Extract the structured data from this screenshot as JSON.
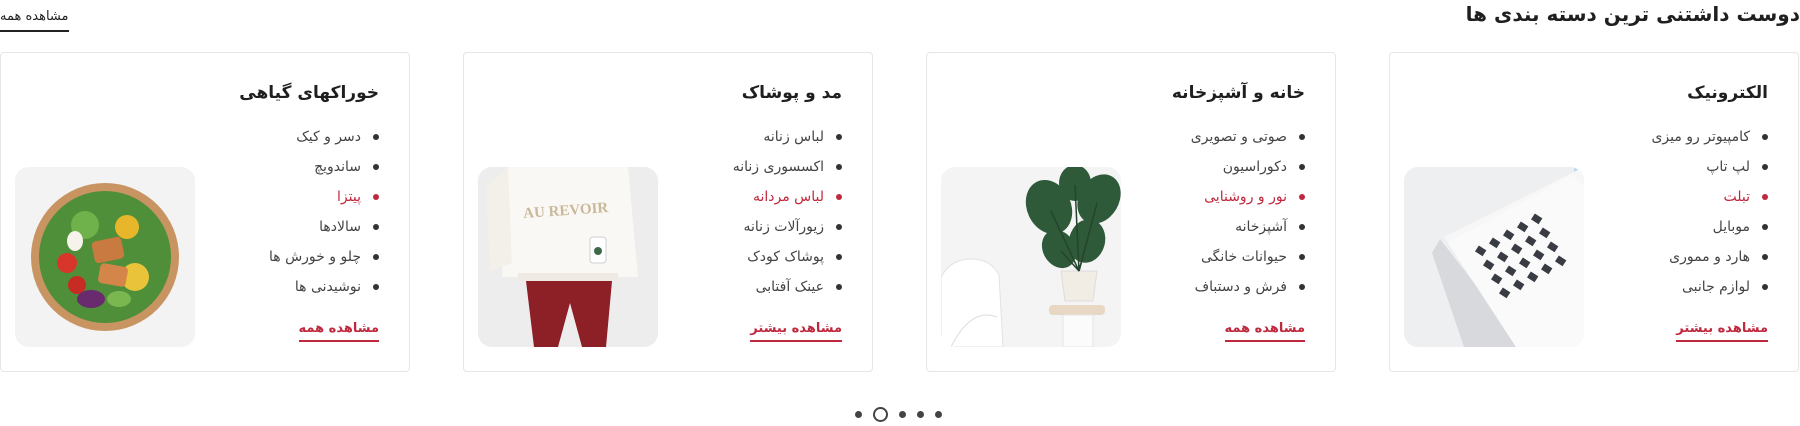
{
  "header": {
    "title": "دوست داشتنی ترین دسته بندی ها",
    "view_all": "مشاهده همه"
  },
  "accent_color": "#c0283d",
  "cards": [
    {
      "title": "الکترونیک",
      "items": [
        "کامپیوتر رو میزی",
        "لپ تاپ",
        "تبلت",
        "موبایل",
        "هارد و مموری",
        "لوازم جانبی"
      ],
      "active_item": "تبلت",
      "more": "مشاهده بیشتر",
      "image": "laptop-image"
    },
    {
      "title": "خانه و آشپزخانه",
      "items": [
        "صوتی و تصویری",
        "دکوراسیون",
        "نور و روشنایی",
        "آشپزخانه",
        "حیوانات خانگی",
        "فرش و دستباف"
      ],
      "active_item": "نور و روشنایی",
      "more": "مشاهده همه",
      "image": "plant-chair-image"
    },
    {
      "title": "مد و پوشاک",
      "items": [
        "لباس زنانه",
        "اکسسوری زنانه",
        "لباس مردانه",
        "زیورآلات زنانه",
        "پوشاک کودک",
        "عینک آفتابی"
      ],
      "active_item": "لباس مردانه",
      "more": "مشاهده بیشتر",
      "image": "sweater-image",
      "image_text": "AU REVOIR"
    },
    {
      "title": "خوراکهای گیاهی",
      "items": [
        "دسر و کیک",
        "ساندویچ",
        "پیتزا",
        "سالادها",
        "چلو و خورش ها",
        "نوشیدنی ها"
      ],
      "active_item": "پیتزا",
      "more": "مشاهده همه",
      "image": "salad-bowl-image"
    }
  ],
  "pagination": {
    "count": 5,
    "active_index": 1
  }
}
